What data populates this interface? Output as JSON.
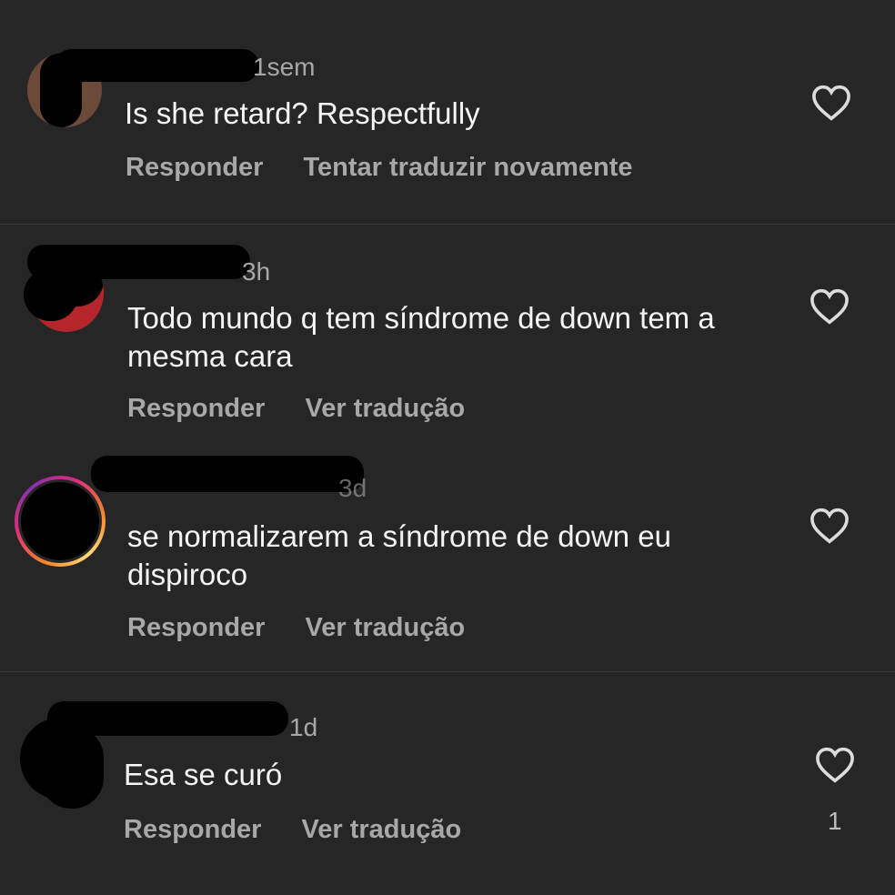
{
  "comments": [
    {
      "time": "1sem",
      "text": "Is she retard? Respectfully",
      "reply_label": "Responder",
      "translate_label": "Tentar traduzir novamente",
      "like_count": ""
    },
    {
      "time": "3h",
      "text": "Todo mundo q tem síndrome de down tem a mesma cara",
      "reply_label": "Responder",
      "translate_label": "Ver tradução",
      "like_count": ""
    },
    {
      "time": "3d",
      "text": "se normalizarem a síndrome de down eu dispiroco",
      "reply_label": "Responder",
      "translate_label": "Ver tradução",
      "like_count": ""
    },
    {
      "time": "1d",
      "text": "Esa se curó",
      "reply_label": "Responder",
      "translate_label": "Ver tradução",
      "like_count": "1"
    }
  ],
  "icons": {
    "like": "heart-outline-icon"
  },
  "colors": {
    "background": "#262626",
    "text": "#f5f5f5",
    "secondary": "#a8a8a8"
  }
}
